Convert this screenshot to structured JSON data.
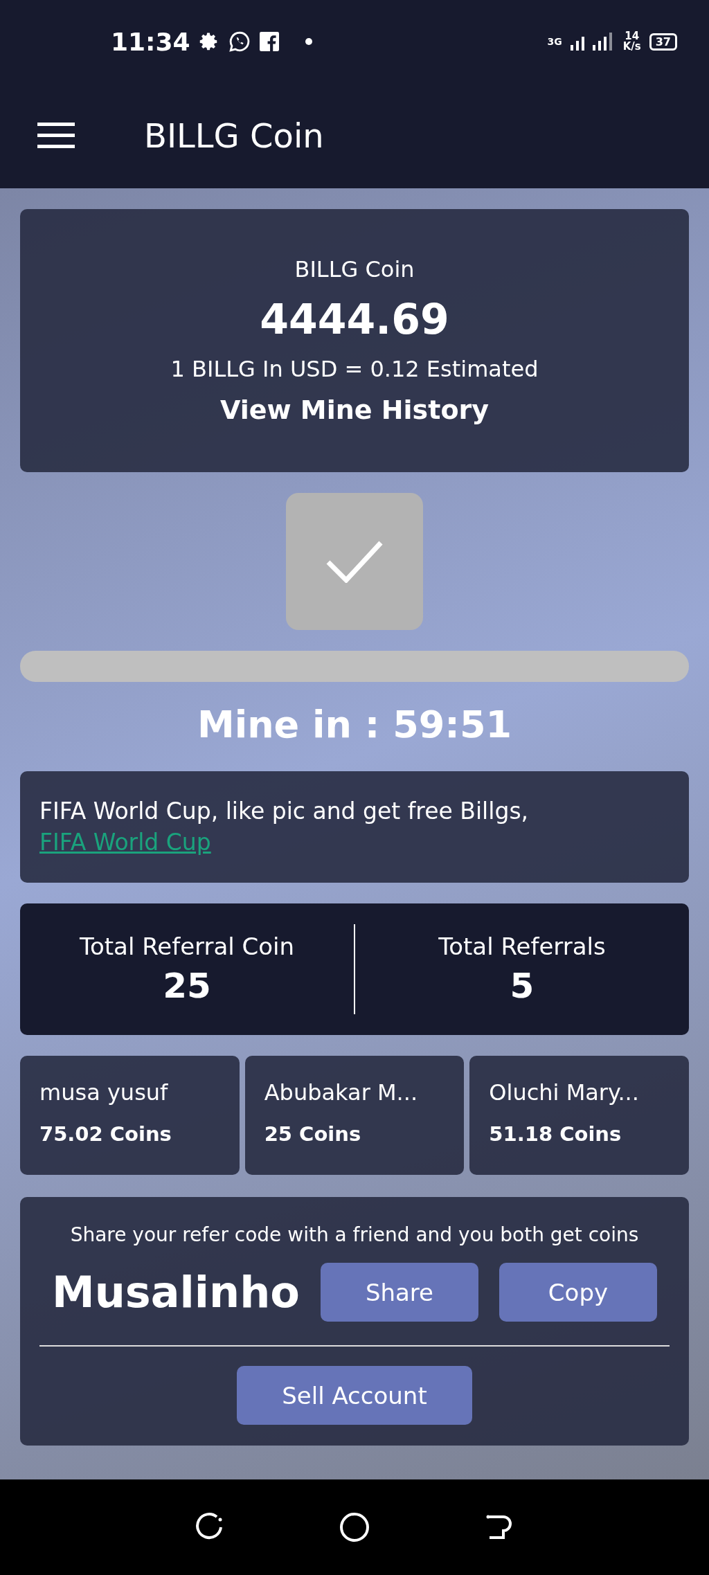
{
  "status_bar": {
    "time": "11:34",
    "network_type": "3G",
    "speed_value": "14",
    "speed_unit": "K/s",
    "battery": "37"
  },
  "app_bar": {
    "title": "BILLG Coin"
  },
  "balance_card": {
    "title": "BILLG Coin",
    "amount": "4444.69",
    "rate": "1 BILLG In USD = 0.12 Estimated",
    "history_link": "View Mine History"
  },
  "mine": {
    "level": 0,
    "countdown": "Mine in : 59:51"
  },
  "announcement": {
    "text": "FIFA World Cup, like pic and get free Billgs,",
    "link": "FIFA World Cup"
  },
  "referral_stats": [
    {
      "label": "Total Referral Coin",
      "value": "25"
    },
    {
      "label": "Total Referrals",
      "value": "5"
    }
  ],
  "referrals": [
    {
      "name": "musa yusuf",
      "coins": "75.02 Coins"
    },
    {
      "name": "Abubakar M...",
      "coins": "25 Coins"
    },
    {
      "name": "Oluchi Mary...",
      "coins": "51.18 Coins"
    }
  ],
  "share": {
    "text": "Share your refer code with a friend and you both get coins",
    "code": "Musalinho",
    "buttons": [
      "Share",
      "Copy"
    ],
    "sell_button": "Sell Account"
  }
}
